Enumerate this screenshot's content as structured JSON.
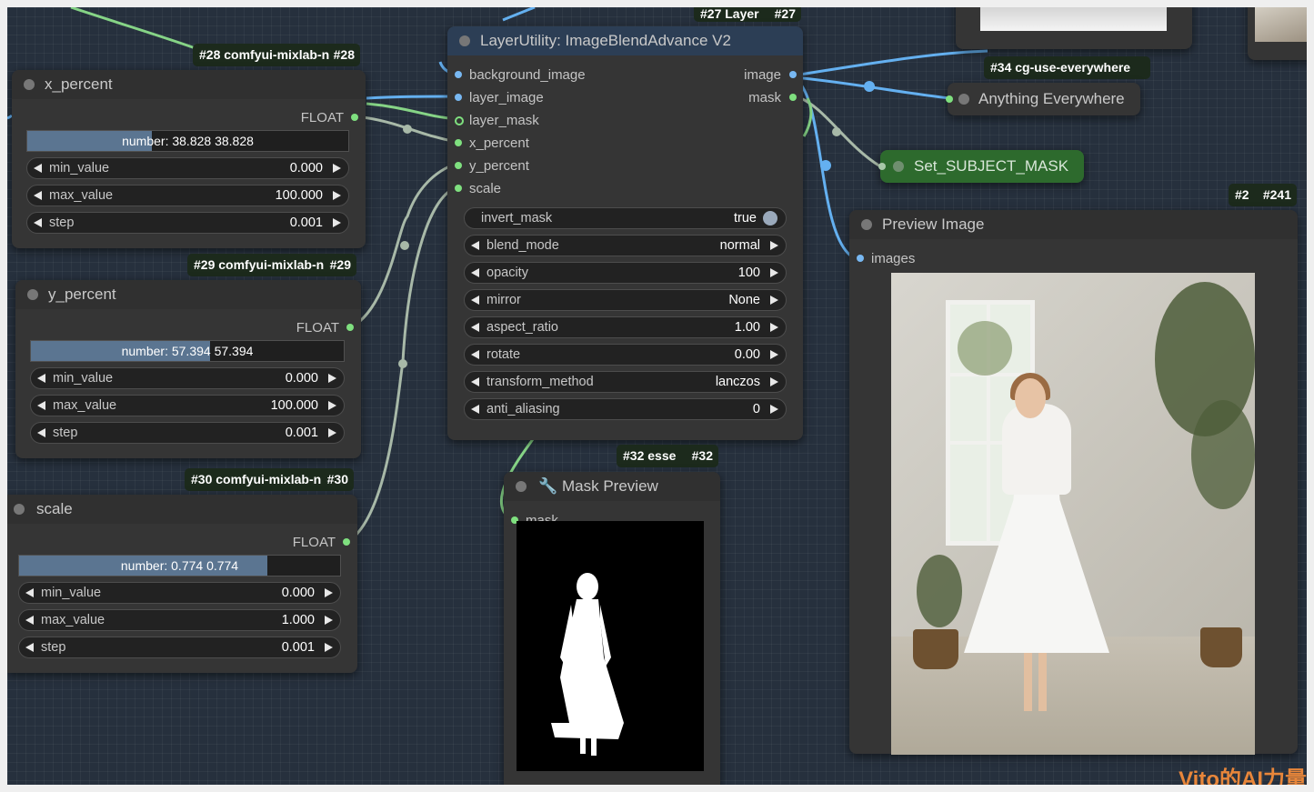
{
  "nodes": {
    "x_percent": {
      "badge": "#28 comfyui-mixlab-n",
      "badge_id": "#28",
      "title": "x_percent",
      "output": "FLOAT",
      "number_text": "number: 38.828  38.828",
      "number_value": 38.828,
      "widgets": [
        {
          "label": "min_value",
          "value": "0.000"
        },
        {
          "label": "max_value",
          "value": "100.000"
        },
        {
          "label": "step",
          "value": "0.001"
        }
      ]
    },
    "y_percent": {
      "badge": "#29 comfyui-mixlab-n",
      "badge_id": "#29",
      "title": "y_percent",
      "output": "FLOAT",
      "number_text": "number: 57.394  57.394",
      "number_value": 57.394,
      "widgets": [
        {
          "label": "min_value",
          "value": "0.000"
        },
        {
          "label": "max_value",
          "value": "100.000"
        },
        {
          "label": "step",
          "value": "0.001"
        }
      ]
    },
    "scale": {
      "badge": "#30 comfyui-mixlab-n",
      "badge_id": "#30",
      "title": "scale",
      "output": "FLOAT",
      "number_text": "number: 0.774  0.774",
      "number_value": 0.774,
      "widgets": [
        {
          "label": "min_value",
          "value": "0.000"
        },
        {
          "label": "max_value",
          "value": "1.000"
        },
        {
          "label": "step",
          "value": "0.001"
        }
      ]
    },
    "blend": {
      "badge": "#27 Layer",
      "badge_id": "#27",
      "title": "LayerUtility: ImageBlendAdvance V2",
      "inputs": [
        "background_image",
        "layer_image",
        "layer_mask",
        "x_percent",
        "y_percent",
        "scale"
      ],
      "outputs": [
        "image",
        "mask"
      ],
      "invert_mask": {
        "label": "invert_mask",
        "value": "true"
      },
      "widgets": [
        {
          "label": "blend_mode",
          "value": "normal"
        },
        {
          "label": "opacity",
          "value": "100"
        },
        {
          "label": "mirror",
          "value": "None"
        },
        {
          "label": "aspect_ratio",
          "value": "1.00"
        },
        {
          "label": "rotate",
          "value": "0.00"
        },
        {
          "label": "transform_method",
          "value": "lanczos"
        },
        {
          "label": "anti_aliasing",
          "value": "0"
        }
      ]
    },
    "anything": {
      "badge": "#34 cg-use-everywhere",
      "title": "Anything Everywhere"
    },
    "set_mask": {
      "title": "Set_SUBJECT_MASK"
    },
    "preview": {
      "badge": "#2",
      "badge_id": "#241",
      "title": "Preview Image",
      "input": "images"
    },
    "mask_preview": {
      "badge": "#32 esse",
      "badge_id": "#32",
      "title": "Mask Preview",
      "input": "mask"
    }
  },
  "watermark": "Vito的AI力量",
  "colors": {
    "canvas": "#26303d",
    "node": "#353535",
    "slider_fill": "#5b7591",
    "set_node": "#2d6a2d",
    "link_float": "#a8b9a8",
    "link_image": "#64b0f0",
    "watermark": "#e8863a"
  }
}
